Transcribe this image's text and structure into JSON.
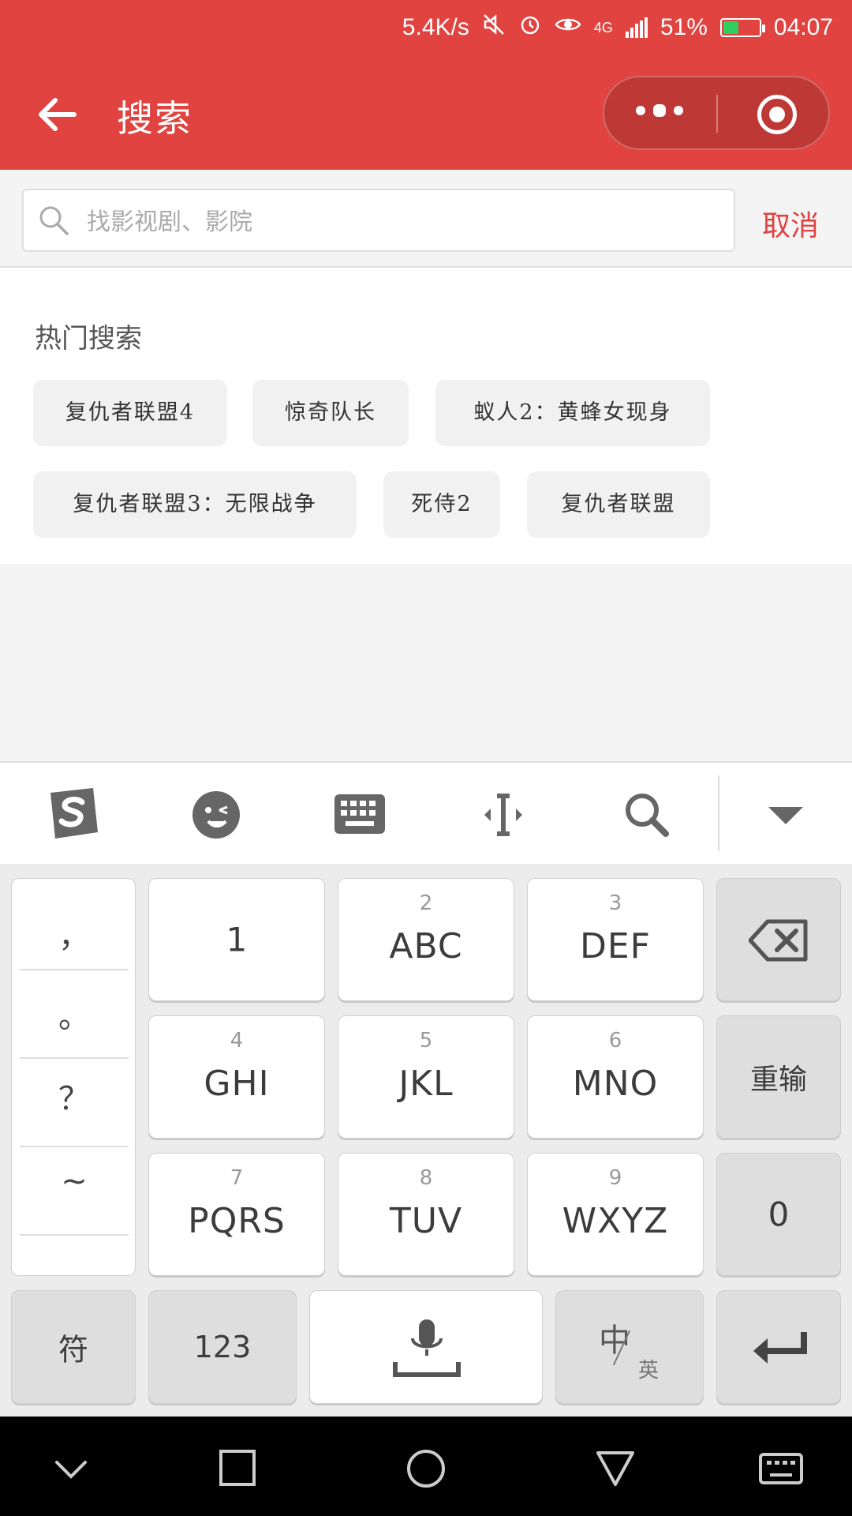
{
  "status_bar": {
    "net_speed": "5.4K/s",
    "network": "4G",
    "battery": "51%",
    "time": "04:07",
    "battery_color": "#2fcf5f"
  },
  "header": {
    "title": "搜索",
    "accent_color": "#e04340",
    "icons": [
      "back-arrow-icon",
      "more-dots-icon",
      "target-icon"
    ]
  },
  "search": {
    "placeholder": "找影视剧、影院",
    "value": "",
    "cancel_label": "取消"
  },
  "hot_search": {
    "title": "热门搜索",
    "tags": [
      "复仇者联盟4",
      "惊奇队长",
      "蚁人2：黄蜂女现身",
      "复仇者联盟3：无限战争",
      "死侍2",
      "复仇者联盟"
    ]
  },
  "keyboard": {
    "toolbar_icons": [
      "sogou-logo-icon",
      "emoji-icon",
      "keyboard-icon",
      "cursor-icon",
      "search-icon",
      "collapse-icon"
    ],
    "punctuation": [
      "，",
      "。",
      "？",
      "~"
    ],
    "keys": [
      {
        "num": "",
        "letters": "1"
      },
      {
        "num": "2",
        "letters": "ABC"
      },
      {
        "num": "3",
        "letters": "DEF"
      },
      {
        "num": "4",
        "letters": "GHI"
      },
      {
        "num": "5",
        "letters": "JKL"
      },
      {
        "num": "6",
        "letters": "MNO"
      },
      {
        "num": "7",
        "letters": "PQRS"
      },
      {
        "num": "8",
        "letters": "TUV"
      },
      {
        "num": "9",
        "letters": "WXYZ"
      }
    ],
    "reinput_label": "重输",
    "zero_label": "0",
    "symbol_label": "符",
    "numbers_label": "123",
    "lang_main": "中",
    "lang_sub": "英"
  },
  "navbar": {
    "icons": [
      "chevron-down-icon",
      "square-icon",
      "circle-icon",
      "triangle-icon",
      "keyboard-icon"
    ]
  }
}
